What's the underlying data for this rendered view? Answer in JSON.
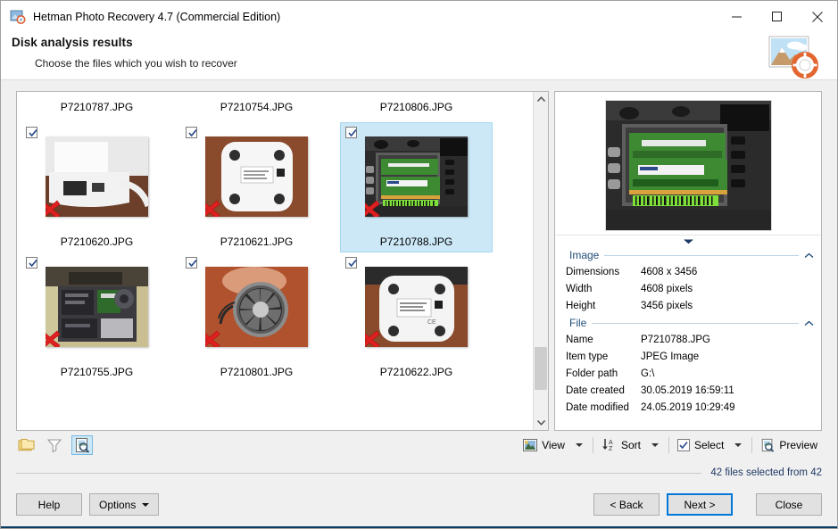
{
  "window": {
    "title": "Hetman Photo Recovery 4.7 (Commercial Edition)",
    "icon": "app-icon",
    "minimize_label": "–",
    "maximize_label": "□",
    "close_label": "✕"
  },
  "header": {
    "title": "Disk analysis results",
    "subtitle": "Choose the files which you wish to recover",
    "logo": "photo-recovery-logo"
  },
  "thumbnails": {
    "rows": [
      {
        "cells": [
          {
            "caption": "P7210787.JPG",
            "checked": true,
            "selected": false,
            "deleted": true,
            "image": "white-router-side",
            "visible_image": false
          },
          {
            "caption": "P7210754.JPG",
            "checked": true,
            "selected": false,
            "deleted": true,
            "image": "white-device-top",
            "visible_image": false
          },
          {
            "caption": "P7210806.JPG",
            "checked": true,
            "selected": false,
            "deleted": true,
            "image": "laptop-internals",
            "visible_image": false
          }
        ]
      },
      {
        "cells": [
          {
            "caption": "P7210620.JPG",
            "checked": true,
            "selected": false,
            "deleted": true,
            "image": "white-router-port",
            "visible_image": true
          },
          {
            "caption": "P7210621.JPG",
            "checked": true,
            "selected": false,
            "deleted": true,
            "image": "white-device-bottom",
            "visible_image": true
          },
          {
            "caption": "P7210788.JPG",
            "checked": true,
            "selected": true,
            "deleted": true,
            "image": "laptop-ram-modules",
            "visible_image": true
          }
        ]
      },
      {
        "cells": [
          {
            "caption": "P7210755.JPG",
            "checked": true,
            "selected": false,
            "deleted": true,
            "image": "laptop-open-chassis",
            "visible_image": true
          },
          {
            "caption": "P7210801.JPG",
            "checked": true,
            "selected": false,
            "deleted": true,
            "image": "cooling-fan",
            "visible_image": true
          },
          {
            "caption": "P7210622.JPG",
            "checked": true,
            "selected": false,
            "deleted": true,
            "image": "white-device-label",
            "visible_image": true
          }
        ]
      }
    ],
    "scrollbar": {
      "up_arrow": "chevron-up",
      "down_arrow": "chevron-down",
      "thumb_position_pct": 78,
      "thumb_size_pct": 14
    }
  },
  "preview": {
    "image": "laptop-ram-modules-preview",
    "splitter": "chevron-down"
  },
  "properties": {
    "groups": [
      {
        "label": "Image",
        "collapse_icon": "chevron-up",
        "rows": [
          {
            "key": "Dimensions",
            "value": "4608 x 3456"
          },
          {
            "key": "Width",
            "value": "4608 pixels"
          },
          {
            "key": "Height",
            "value": "3456 pixels"
          }
        ]
      },
      {
        "label": "File",
        "collapse_icon": "chevron-up",
        "rows": [
          {
            "key": "Name",
            "value": "P7210788.JPG"
          },
          {
            "key": "Item type",
            "value": "JPEG Image"
          },
          {
            "key": "Folder path",
            "value": "G:\\"
          },
          {
            "key": "Date created",
            "value": "30.05.2019 16:59:11"
          },
          {
            "key": "Date modified",
            "value": "24.05.2019 10:29:49"
          }
        ]
      }
    ]
  },
  "toolbar": {
    "left_tools": [
      {
        "name": "folders-icon",
        "label": "Folders",
        "active": false
      },
      {
        "name": "filter-icon",
        "label": "Filter",
        "active": false
      },
      {
        "name": "preview-search-icon",
        "label": "Preview",
        "active": true
      }
    ],
    "view_label": "View",
    "sort_label": "Sort",
    "select_label": "Select",
    "preview_label": "Preview"
  },
  "status": {
    "text": "42 files selected from 42"
  },
  "footer": {
    "help_label": "Help",
    "options_label": "Options",
    "back_label": "< Back",
    "next_label": "Next >",
    "close_label": "Close"
  },
  "colors": {
    "accent": "#0078d7",
    "selection": "#cce8f7",
    "group_label": "#1f4e79",
    "status_text": "#1f3864",
    "chrome": "#f0f0f0",
    "button_face": "#e1e1e1",
    "delete_mark": "#e02020"
  }
}
